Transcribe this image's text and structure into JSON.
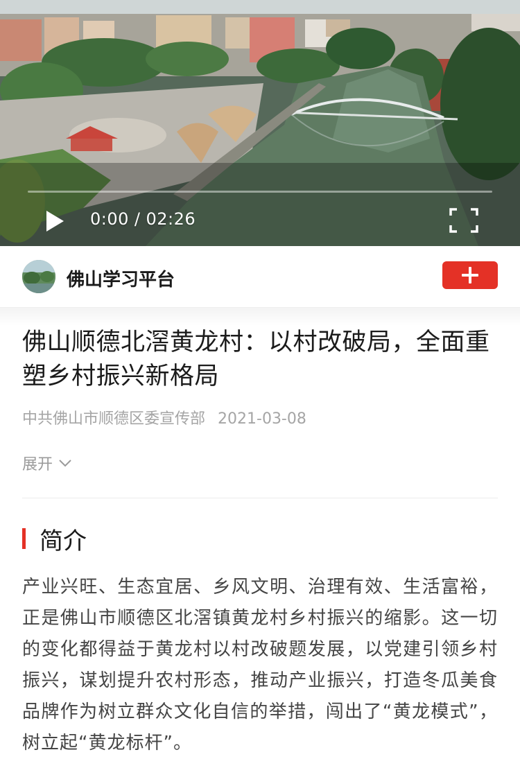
{
  "player": {
    "current_time": "0:00",
    "separator": "/",
    "duration": "02:26",
    "progress": 0,
    "play_icon": "play-icon",
    "fullscreen_icon": "fullscreen-icon"
  },
  "channel": {
    "name": "佛山学习平台",
    "follow_icon": "plus-icon",
    "follow_color": "#e43126"
  },
  "article": {
    "title": "佛山顺德北滘黄龙村：以村改破局，全面重塑乡村振兴新格局",
    "source": "中共佛山市顺德区委宣传部",
    "date": "2021-03-08",
    "expand_label": "展开",
    "section_title": "简介",
    "intro": "产业兴旺、生态宜居、乡风文明、治理有效、生活富裕，正是佛山市顺德区北滘镇黄龙村乡村振兴的缩影。这一切的变化都得益于黄龙村以村改破题发展，以党建引领乡村振兴，谋划提升农村形态，推动产业振兴，打造冬瓜美食品牌作为树立群众文化自信的举措，闯出了“黄龙模式”，树立起“黄龙标杆”。"
  },
  "colors": {
    "accent": "#e43126",
    "meta_text": "#a5a5a5",
    "body_text": "#444444"
  }
}
